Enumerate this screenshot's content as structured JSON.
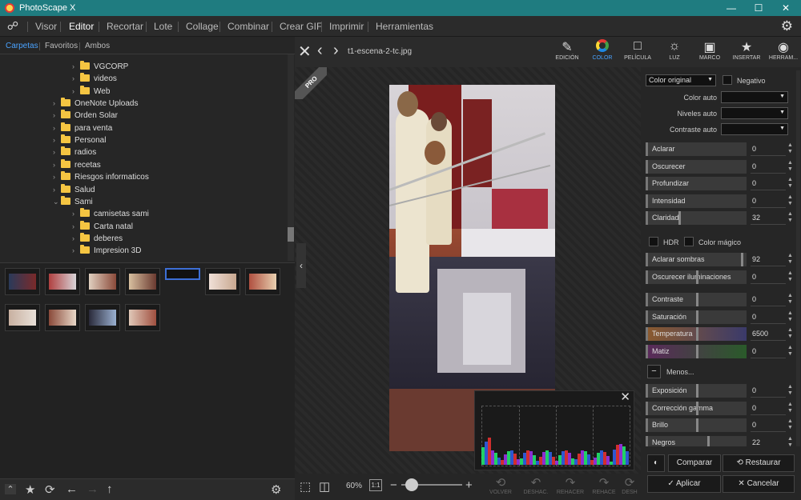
{
  "window": {
    "title": "PhotoScape X",
    "minimize": "—",
    "maximize": "☐",
    "close": "✕"
  },
  "menu": {
    "items": [
      "Visor",
      "Editor",
      "Recortar",
      "Lote",
      "Collage",
      "Combinar",
      "Crear GIF",
      "Imprimir",
      "Herramientas"
    ],
    "active": "Editor"
  },
  "left_tabs": [
    "Carpetas",
    "Favoritos",
    "Ambos"
  ],
  "tree": [
    {
      "label": "VGCORP",
      "level": 2
    },
    {
      "label": "videos",
      "level": 2
    },
    {
      "label": "Web",
      "level": 2
    },
    {
      "label": "OneNote Uploads",
      "level": 1
    },
    {
      "label": "Orden Solar",
      "level": 1
    },
    {
      "label": "para venta",
      "level": 1
    },
    {
      "label": "Personal",
      "level": 1
    },
    {
      "label": "radios",
      "level": 1
    },
    {
      "label": "recetas",
      "level": 1
    },
    {
      "label": "Riesgos informaticos",
      "level": 1
    },
    {
      "label": "Salud",
      "level": 1
    },
    {
      "label": "Sami",
      "level": 1,
      "expanded": true
    },
    {
      "label": "camisetas sami",
      "level": 2
    },
    {
      "label": "Carta natal",
      "level": 2
    },
    {
      "label": "deberes",
      "level": 2
    },
    {
      "label": "Impresion 3D",
      "level": 2
    }
  ],
  "thumbnails": {
    "count": 11,
    "selected_index": 4
  },
  "file": {
    "name": "t1-escena-2-tc.jpg"
  },
  "pro_badge": "PRO",
  "zoom": {
    "level": "60%",
    "one_to_one": "1:1"
  },
  "actions": [
    "VOLVER",
    "DESHAC.",
    "REHACER",
    "REHACE",
    "DESH"
  ],
  "tools": [
    {
      "label": "EDICIÓN",
      "icon": "edit-icon"
    },
    {
      "label": "COLOR",
      "icon": "color-wheel-icon",
      "active": true
    },
    {
      "label": "PELÍCULA",
      "icon": "film-icon"
    },
    {
      "label": "LUZ",
      "icon": "sun-icon"
    },
    {
      "label": "MARCO",
      "icon": "frame-icon"
    },
    {
      "label": "INSERTAR",
      "icon": "insert-icon"
    },
    {
      "label": "HERRAM...",
      "icon": "palette-icon"
    }
  ],
  "panel": {
    "color_mode": "Color original",
    "negative_label": "Negativo",
    "auto": [
      {
        "label": "Color auto"
      },
      {
        "label": "Niveles auto"
      },
      {
        "label": "Contraste auto"
      }
    ],
    "group1": [
      {
        "label": "Aclarar",
        "value": "0"
      },
      {
        "label": "Oscurecer",
        "value": "0"
      },
      {
        "label": "Profundizar",
        "value": "0"
      },
      {
        "label": "Intensidad",
        "value": "0"
      },
      {
        "label": "Claridad",
        "value": "32"
      }
    ],
    "hdr_label": "HDR",
    "magic_label": "Color mágico",
    "group2": [
      {
        "label": "Aclarar sombras",
        "value": "92"
      },
      {
        "label": "Oscurecer iluminaciones",
        "value": "0"
      }
    ],
    "group3": [
      {
        "label": "Contraste",
        "value": "0"
      },
      {
        "label": "Saturación",
        "value": "0"
      },
      {
        "label": "Temperatura",
        "value": "6500"
      },
      {
        "label": "Matiz",
        "value": "0"
      }
    ],
    "less_label": "Menos...",
    "group4": [
      {
        "label": "Exposición",
        "value": "0"
      },
      {
        "label": "Corrección gamma",
        "value": "0"
      },
      {
        "label": "Brillo",
        "value": "0"
      },
      {
        "label": "Negros",
        "value": "22"
      }
    ]
  },
  "footer": {
    "compare": "Comparar",
    "restore": "Restaurar",
    "apply": "Aplicar",
    "cancel": "Cancelar"
  },
  "colors": {
    "accent": "#4aa3ff",
    "titlebar": "#1f7c80",
    "selection": "#3d6fd6"
  }
}
